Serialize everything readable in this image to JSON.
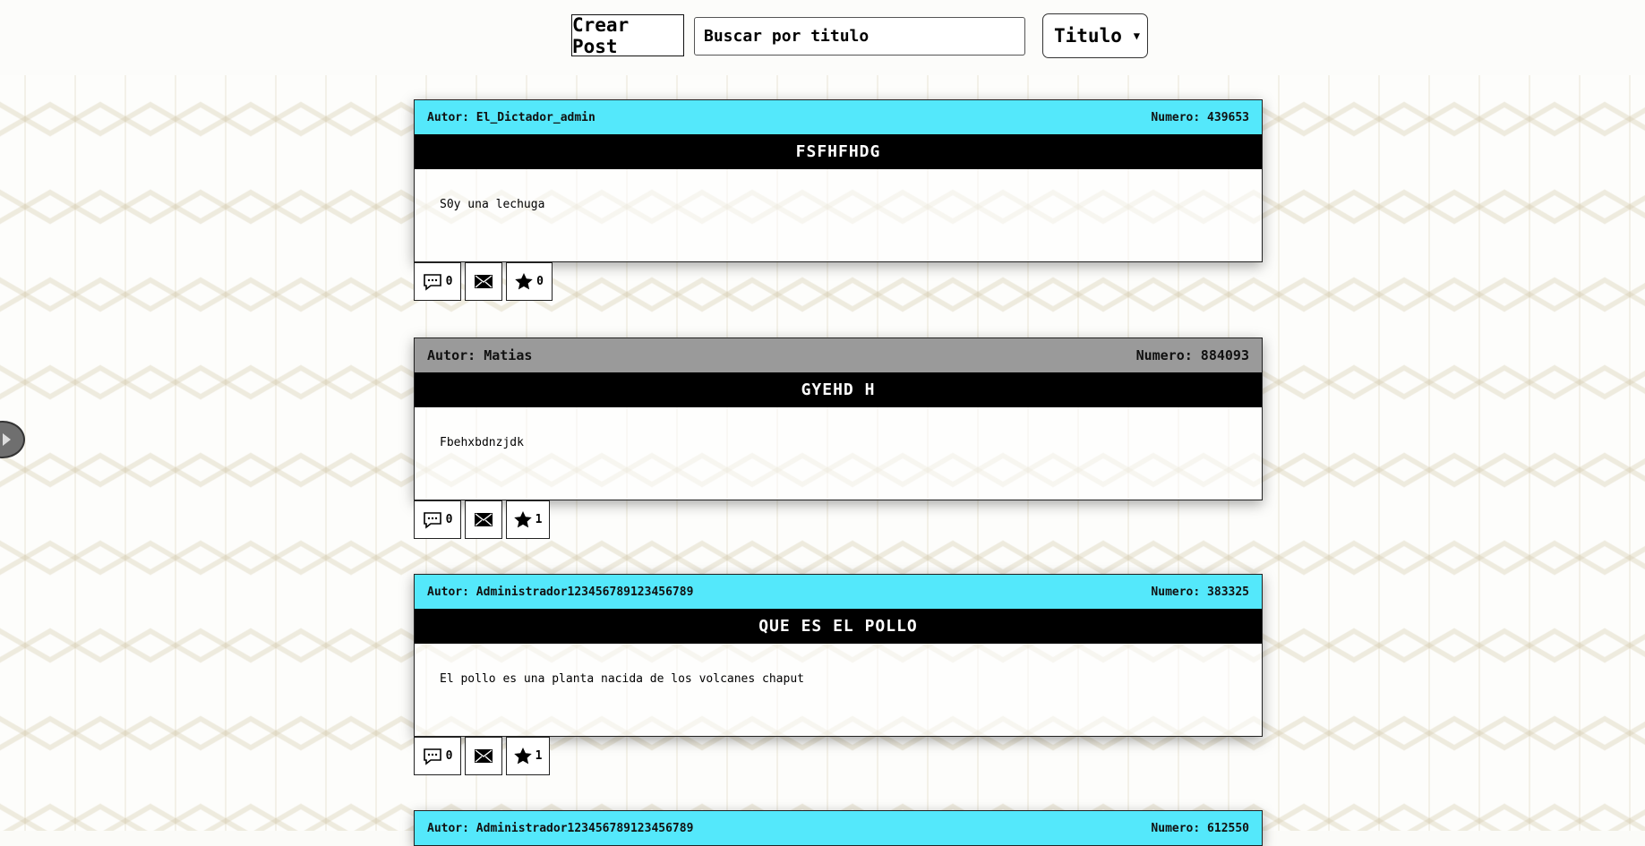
{
  "toolbar": {
    "create_label": "Crear Post",
    "search_placeholder": "Buscar por titulo",
    "sort_value": "Titulo"
  },
  "posts": [
    {
      "author": "Autor: El_Dictador_admin",
      "number": "Numero: 439653",
      "title": "FSFHFHDG",
      "body": "S0y una lechuga",
      "comments": "0",
      "stars": "0",
      "header_color": "#54e8fb"
    },
    {
      "author": "Autor: Matias",
      "number": "Numero: 884093",
      "title": "GYEHD H",
      "body": "Fbehxbdnzjdk",
      "comments": "0",
      "stars": "1",
      "header_color": "#9a9a9a"
    },
    {
      "author": "Autor: Administrador123456789123456789",
      "number": "Numero: 383325",
      "title": "QUE ES EL POLLO",
      "body": "El pollo es una planta nacida de los volcanes chaput",
      "comments": "0",
      "stars": "1",
      "header_color": "#54e8fb"
    },
    {
      "author": "Autor: Administrador123456789123456789",
      "number": "Numero: 612550",
      "header_color": "#54e8fb"
    }
  ]
}
